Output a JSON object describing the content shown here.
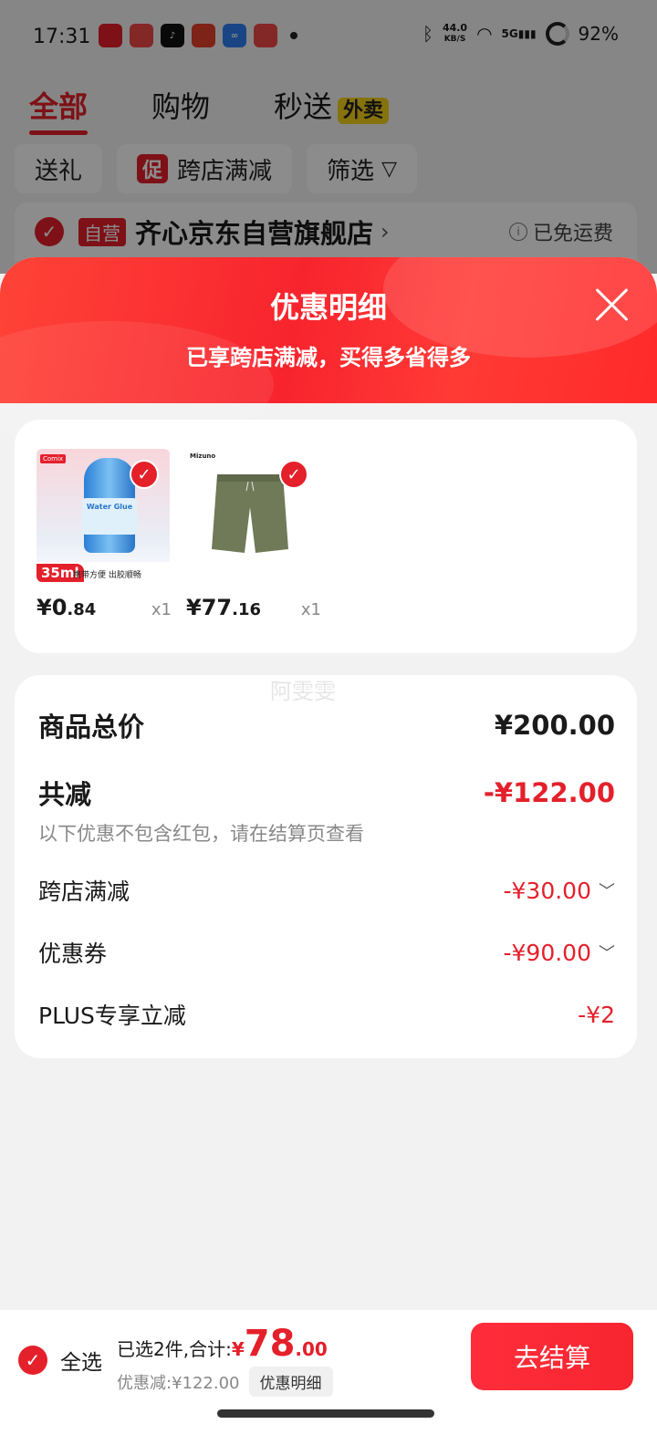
{
  "status_bar": {
    "time": "17:31",
    "apps": [
      "头条",
      "头条",
      "抖音",
      "值",
      "百度",
      "头条"
    ],
    "net_speed": "44.0",
    "net_unit": "KB/S",
    "signal": "5G",
    "battery": "92%"
  },
  "tabs": {
    "all": "全部",
    "shopping": "购物",
    "flash": "秒送",
    "flash_badge": "外卖"
  },
  "chips": {
    "gift": "送礼",
    "promo_tag": "促",
    "cross_store": "跨店满减",
    "filter": "筛选"
  },
  "store": {
    "self_tag": "自营",
    "name": "齐心京东自营旗舰店",
    "free_shipping": "已免运费"
  },
  "sheet": {
    "title": "优惠明细",
    "subtitle": "已享跨店满减，买得多省得多"
  },
  "products": [
    {
      "price_int": "¥0",
      "price_dec": ".84",
      "qty": "x1",
      "image": "glue-product",
      "img_badge": "35ml",
      "img_caption": "携带方便 出胶顺畅",
      "brand": "Comix"
    },
    {
      "price_int": "¥77",
      "price_dec": ".16",
      "qty": "x1",
      "image": "shorts-product",
      "brand": "Mizuno"
    }
  ],
  "watermark": "阿雯雯",
  "summary": {
    "total_label": "商品总价",
    "total_value": "¥200.00",
    "discount_label": "共减",
    "discount_value": "-¥122.00",
    "hint": "以下优惠不包含红包，请在结算页查看",
    "items": [
      {
        "label": "跨店满减",
        "value": "-¥30.00",
        "expandable": true
      },
      {
        "label": "优惠券",
        "value": "-¥90.00",
        "expandable": true
      },
      {
        "label": "PLUS专享立减",
        "value": "-¥2",
        "expandable": false
      }
    ]
  },
  "bottom": {
    "select_all": "全选",
    "selected_text": "已选2件,合计:",
    "currency": "¥",
    "total_int": "78",
    "total_dec": ".00",
    "discount_text": "优惠减:¥122.00",
    "detail_button": "优惠明细",
    "checkout": "去结算"
  },
  "colors": {
    "accent": "#e4202b",
    "header_gradient_start": "#ff4338",
    "header_gradient_end": "#f8242d"
  }
}
